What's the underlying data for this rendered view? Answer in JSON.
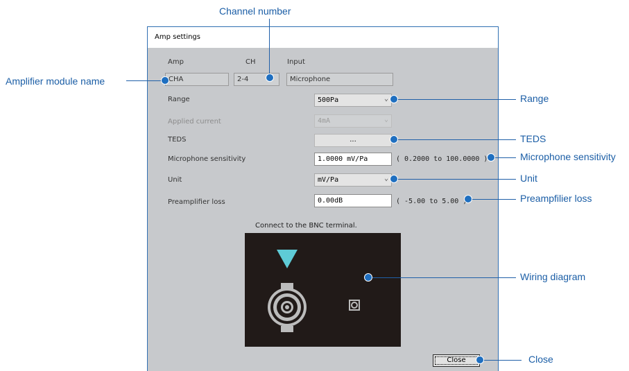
{
  "window": {
    "title": "Amp settings"
  },
  "headers": {
    "amp": "Amp",
    "ch": "CH",
    "input": "Input"
  },
  "amp_values": {
    "amp": "CHA",
    "ch": "2-4",
    "input": "Microphone"
  },
  "rows": {
    "range": {
      "label": "Range",
      "value": "500Pa"
    },
    "applied_current": {
      "label": "Applied current",
      "value": "4mA"
    },
    "teds": {
      "label": "TEDS",
      "button": "..."
    },
    "mic_sensitivity": {
      "label": "Microphone sensitivity",
      "value": "1.0000 mV/Pa",
      "range_hint": "( 0.2000 to 100.0000 )"
    },
    "unit": {
      "label": "Unit",
      "value": "mV/Pa"
    },
    "preamp_loss": {
      "label": "Preamplifier loss",
      "value": "0.00dB",
      "range_hint": "( -5.00 to 5.00 )"
    }
  },
  "diagram": {
    "caption": "Connect to the BNC terminal."
  },
  "close_button": "Close",
  "callouts": {
    "channel_number": "Channel number",
    "amplifier_module_name": "Amplifier module name",
    "range": "Range",
    "teds": "TEDS",
    "microphone_sensitivity": "Microphone sensitivity",
    "unit": "Unit",
    "preamp_loss": "Preampfilier loss",
    "wiring_diagram": "Wiring diagram",
    "close": "Close"
  },
  "colors": {
    "callout": "#1b5ea6",
    "window_border": "#2f6fb2",
    "diagram_bg": "#211a18",
    "marker": "#5ecbd6"
  },
  "icons": {
    "dropdown": "chevron-down-icon",
    "marker": "triangle-down-icon",
    "connector": "bnc-connector-icon",
    "terminal": "terminal-icon"
  }
}
